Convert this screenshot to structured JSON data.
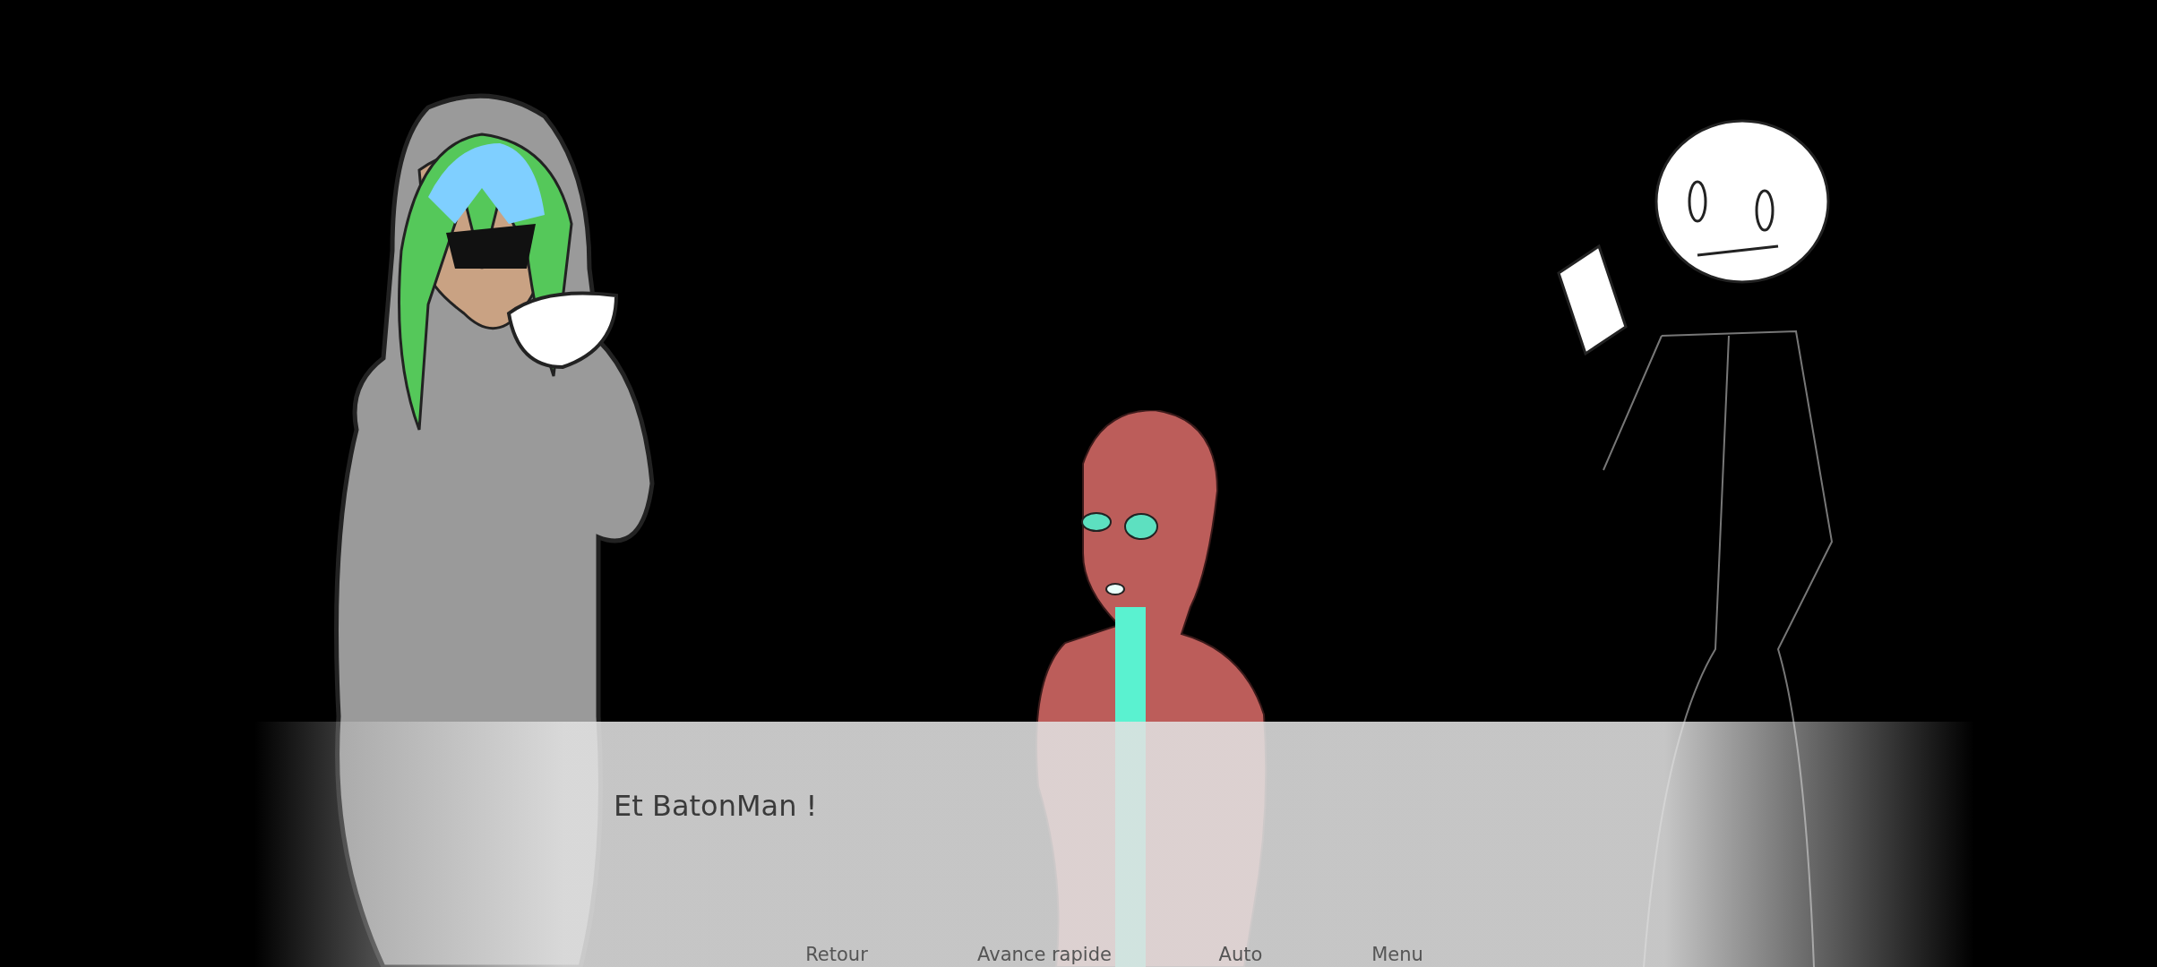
{
  "dialogue": {
    "text": "Et BatonMan !"
  },
  "quick_menu": [
    {
      "label": "Retour"
    },
    {
      "label": "Avance rapide"
    },
    {
      "label": "Auto"
    },
    {
      "label": "Menu"
    }
  ]
}
